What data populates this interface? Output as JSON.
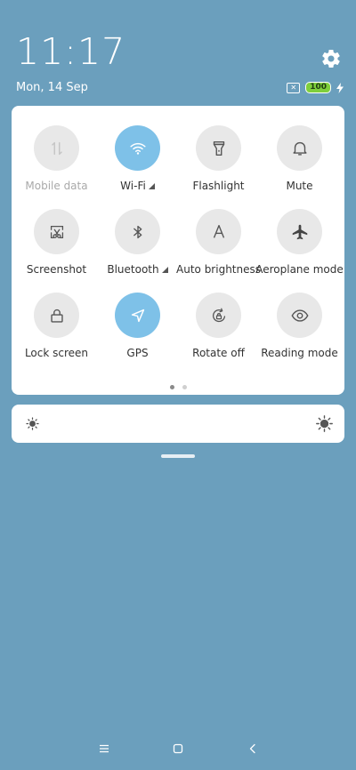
{
  "status": {
    "time": "11:17",
    "date": "Mon, 14 Sep",
    "battery_level": "100",
    "sim_icon": "sim-x-icon",
    "charging_icon": "bolt-icon"
  },
  "settings_icon": "gear-icon",
  "quick_tiles": [
    {
      "label": "Mobile data",
      "icon": "mobile-data-icon",
      "active": false,
      "disabled": true
    },
    {
      "label": "Wi-Fi",
      "icon": "wifi-icon",
      "active": true,
      "disabled": false
    },
    {
      "label": "Flashlight",
      "icon": "flashlight-icon",
      "active": false,
      "disabled": false
    },
    {
      "label": "Mute",
      "icon": "bell-icon",
      "active": false,
      "disabled": false
    },
    {
      "label": "Screenshot",
      "icon": "screenshot-icon",
      "active": false,
      "disabled": false
    },
    {
      "label": "Bluetooth",
      "icon": "bluetooth-icon",
      "active": false,
      "disabled": false
    },
    {
      "label": "Auto brightness",
      "icon": "auto-brightness-icon",
      "active": false,
      "disabled": false
    },
    {
      "label": "Aeroplane mode",
      "icon": "airplane-icon",
      "active": false,
      "disabled": false
    },
    {
      "label": "Lock screen",
      "icon": "lock-icon",
      "active": false,
      "disabled": false
    },
    {
      "label": "GPS",
      "icon": "gps-icon",
      "active": true,
      "disabled": false
    },
    {
      "label": "Rotate off",
      "icon": "rotate-lock-icon",
      "active": false,
      "disabled": false
    },
    {
      "label": "Reading mode",
      "icon": "eye-icon",
      "active": false,
      "disabled": false
    }
  ],
  "pager": {
    "pages": 2,
    "current": 1
  },
  "brightness": {
    "min_icon": "sun-small-icon",
    "max_icon": "sun-large-icon"
  },
  "colors": {
    "background": "#6b9fbd",
    "accent": "#7ec1e8",
    "tile": "#e8e8e8",
    "battery": "#7fcf3c"
  },
  "nav": [
    "menu-icon",
    "home-icon",
    "back-icon"
  ]
}
